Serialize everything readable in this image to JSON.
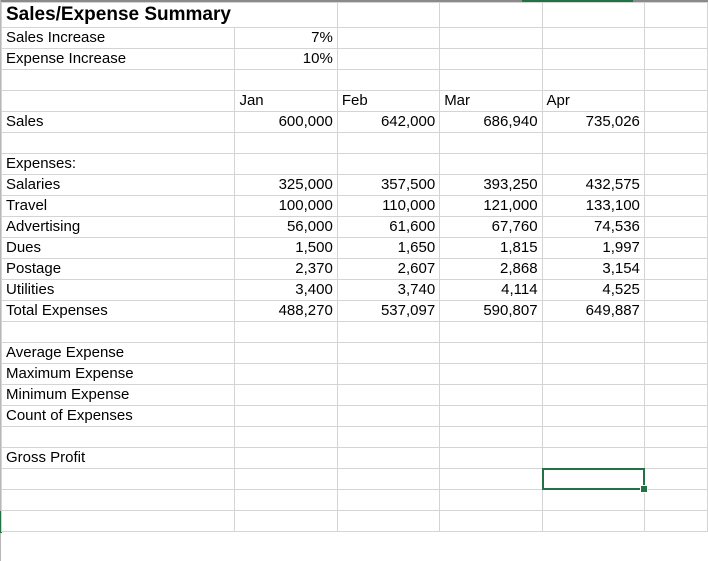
{
  "title": "Sales/Expense Summary",
  "assumptions": [
    {
      "label": "Sales Increase",
      "value": "7%"
    },
    {
      "label": "Expense Increase",
      "value": "10%"
    }
  ],
  "months": [
    "Jan",
    "Feb",
    "Mar",
    "Apr"
  ],
  "sales": {
    "label": "Sales",
    "values": [
      "600,000",
      "642,000",
      "686,940",
      "735,026"
    ]
  },
  "expenses_header": "Expenses:",
  "expenses": [
    {
      "label": "Salaries",
      "values": [
        "325,000",
        "357,500",
        "393,250",
        "432,575"
      ]
    },
    {
      "label": "Travel",
      "values": [
        "100,000",
        "110,000",
        "121,000",
        "133,100"
      ]
    },
    {
      "label": "Advertising",
      "values": [
        "56,000",
        "61,600",
        "67,760",
        "74,536"
      ]
    },
    {
      "label": "Dues",
      "values": [
        "1,500",
        "1,650",
        "1,815",
        "1,997"
      ]
    },
    {
      "label": "Postage",
      "values": [
        "2,370",
        "2,607",
        "2,868",
        "3,154"
      ]
    },
    {
      "label": "Utilities",
      "values": [
        "3,400",
        "3,740",
        "4,114",
        "4,525"
      ]
    }
  ],
  "total_expenses": {
    "label": "Total Expenses",
    "values": [
      "488,270",
      "537,097",
      "590,807",
      "649,887"
    ]
  },
  "stats": [
    "Average Expense",
    "Maximum Expense",
    "Minimum Expense",
    "Count of Expenses"
  ],
  "gross_profit": "Gross Profit",
  "colors": {
    "selection": "#217346",
    "gridline": "#d4d4d4"
  }
}
